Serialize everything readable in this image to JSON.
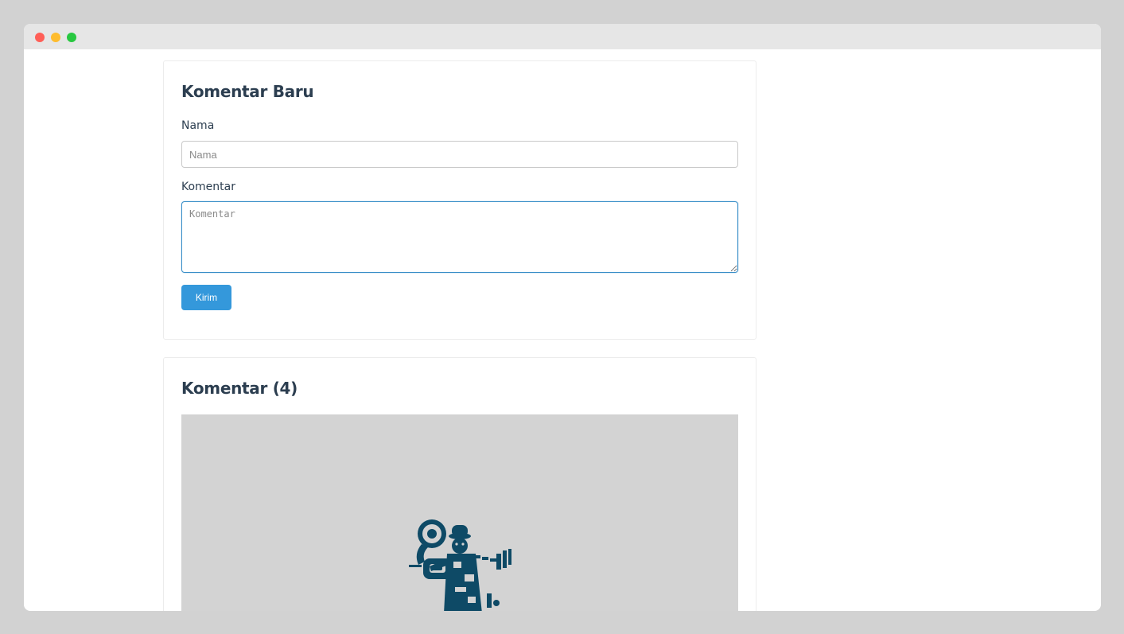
{
  "window": {
    "controls": [
      "close",
      "minimize",
      "maximize"
    ]
  },
  "form": {
    "title": "Komentar Baru",
    "name_label": "Nama",
    "name_placeholder": "Nama",
    "name_value": "",
    "comment_label": "Komentar",
    "comment_placeholder": "Komentar",
    "comment_value": "",
    "submit_label": "Kirim"
  },
  "comments": {
    "title": "Komentar (4)",
    "image_icon": "gramophone-character-illustration"
  },
  "colors": {
    "accent": "#3498db",
    "heading": "#2c3e50",
    "illustration": "#0e4a66",
    "image_bg": "#d3d3d3"
  }
}
